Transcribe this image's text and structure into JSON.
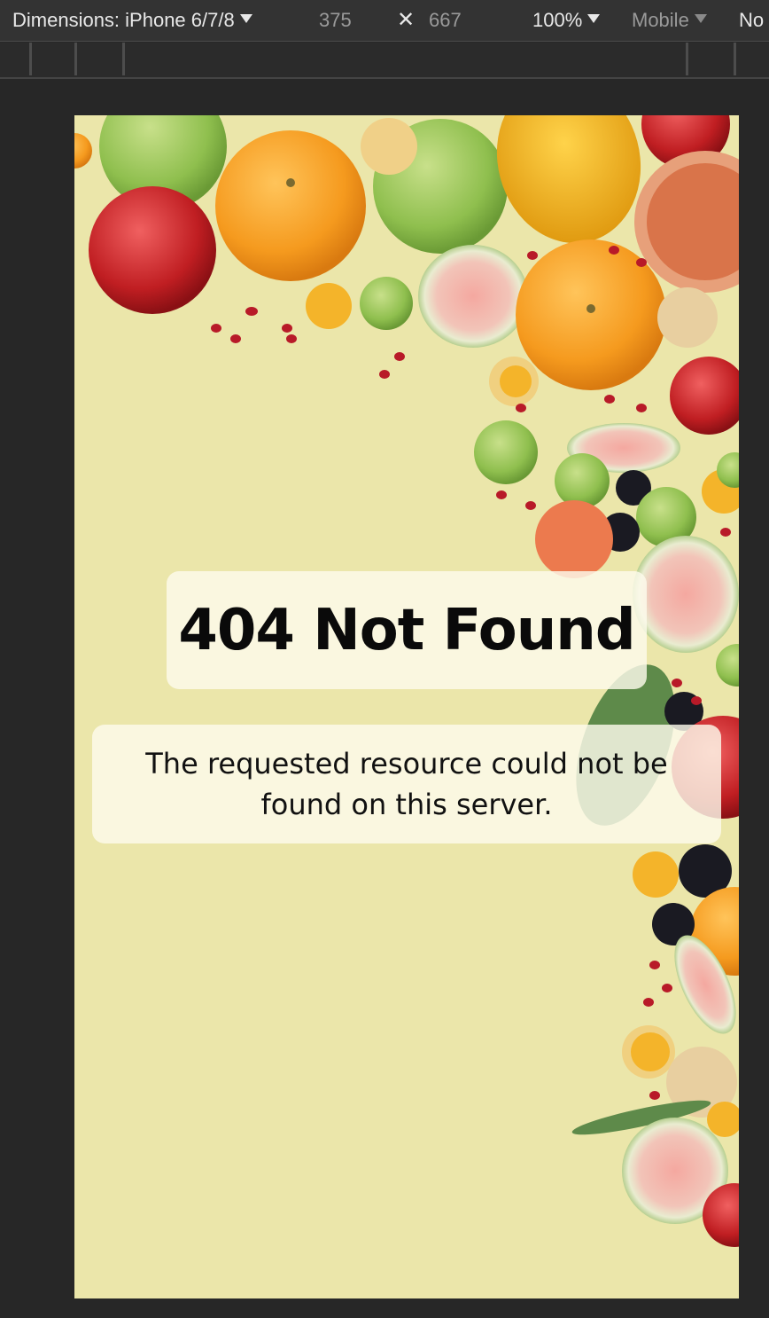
{
  "devtools": {
    "dimensions_label": "Dimensions: iPhone 6/7/8",
    "width": "375",
    "times": "✕",
    "height": "667",
    "zoom": "100%",
    "device_type": "Mobile",
    "throttle": "No"
  },
  "page": {
    "title": "404 Not Found",
    "message": "The requested resource could not be found on this server."
  },
  "colors": {
    "background": "#ebe6aa",
    "toolbar": "#333333"
  }
}
